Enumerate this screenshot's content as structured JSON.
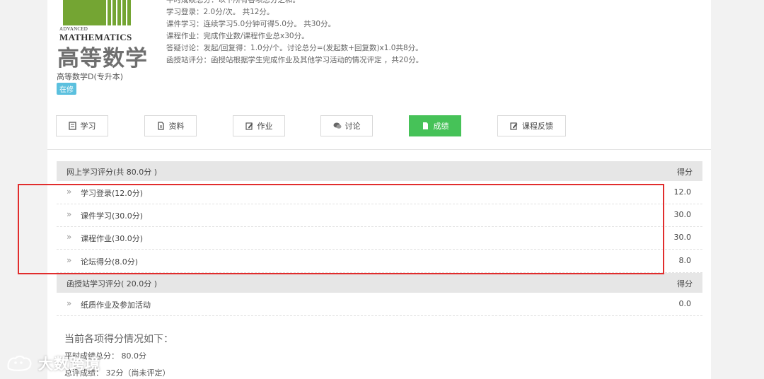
{
  "course": {
    "cover_adv": "ADVANCED",
    "cover_math": "MATHEMATICS",
    "cover_cn": "高等数学",
    "name": "高等数学D(专升本)",
    "status": "在修"
  },
  "rules": [
    "平时成绩总分：以下所有各项总分之和。",
    "学习登录：2.0分/次。 共12分。",
    "课件学习：连续学习5.0分钟可得5.0分。 共30分。",
    "课程作业：完成作业数/课程作业总x30分。",
    "答疑讨论：发起/回复得：1.0分/个。讨论总分=(发起数+回复数)x1.0共8分。",
    "函授站评分：函授站根据学生完成作业及其他学习活动的情况评定 ，共20分。"
  ],
  "tabs": [
    {
      "label": "学习",
      "icon": "book-icon"
    },
    {
      "label": "资料",
      "icon": "document-icon"
    },
    {
      "label": "作业",
      "icon": "edit-icon"
    },
    {
      "label": "讨论",
      "icon": "chat-icon"
    },
    {
      "label": "成绩",
      "icon": "report-icon"
    },
    {
      "label": "课程反馈",
      "icon": "edit-icon"
    }
  ],
  "online": {
    "title": "网上学习评分(共 80.0分 )",
    "score_header": "得分",
    "rows": [
      {
        "name": "学习登录(12.0分)",
        "score": "12.0"
      },
      {
        "name": "课件学习(30.0分)",
        "score": "30.0"
      },
      {
        "name": "课程作业(30.0分)",
        "score": "30.0"
      },
      {
        "name": "论坛得分(8.0分)",
        "score": "8.0"
      }
    ]
  },
  "station": {
    "title": "函授站学习评分( 20.0分 )",
    "score_header": "得分",
    "rows": [
      {
        "name": "纸质作业及参加活动",
        "score": "0.0"
      }
    ]
  },
  "summary": {
    "title": "当前各项得分情况如下：",
    "line1": "平时成绩总分： 80.0分",
    "line2": "总评成绩： 32分（尚未评定）"
  },
  "watermark": "大数跨境",
  "colors": {
    "active_tab": "#46c258",
    "badge": "#5bc0de",
    "highlight_border": "#e12d2d",
    "cover_green": "#74a533"
  }
}
